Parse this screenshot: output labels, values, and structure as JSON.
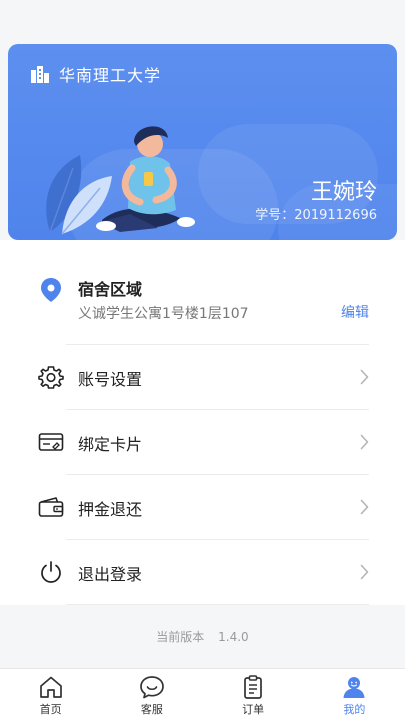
{
  "profile_card": {
    "university": "华南理工大学",
    "name": "王婉玲",
    "student_id": "学号：2019112696",
    "accent_color": "#5d8fef"
  },
  "dorm": {
    "title": "宿舍区域",
    "address": "义诚学生公寓1号楼1层107",
    "edit_label": "编辑",
    "icon": "location-pin-icon"
  },
  "menu_items": [
    {
      "label": "账号设置",
      "icon": "gear-icon"
    },
    {
      "label": "绑定卡片",
      "icon": "card-icon"
    },
    {
      "label": "押金退还",
      "icon": "wallet-icon"
    },
    {
      "label": "退出登录",
      "icon": "power-icon"
    }
  ],
  "version": {
    "label": "当前版本",
    "number": "1.4.0"
  },
  "tabbar": {
    "items": [
      {
        "label": "首页",
        "icon": "home-icon"
      },
      {
        "label": "客服",
        "icon": "chat-icon"
      },
      {
        "label": "订单",
        "icon": "clipboard-icon"
      },
      {
        "label": "我的",
        "icon": "user-icon",
        "active": true
      }
    ],
    "active_color": "#4f84ec"
  }
}
